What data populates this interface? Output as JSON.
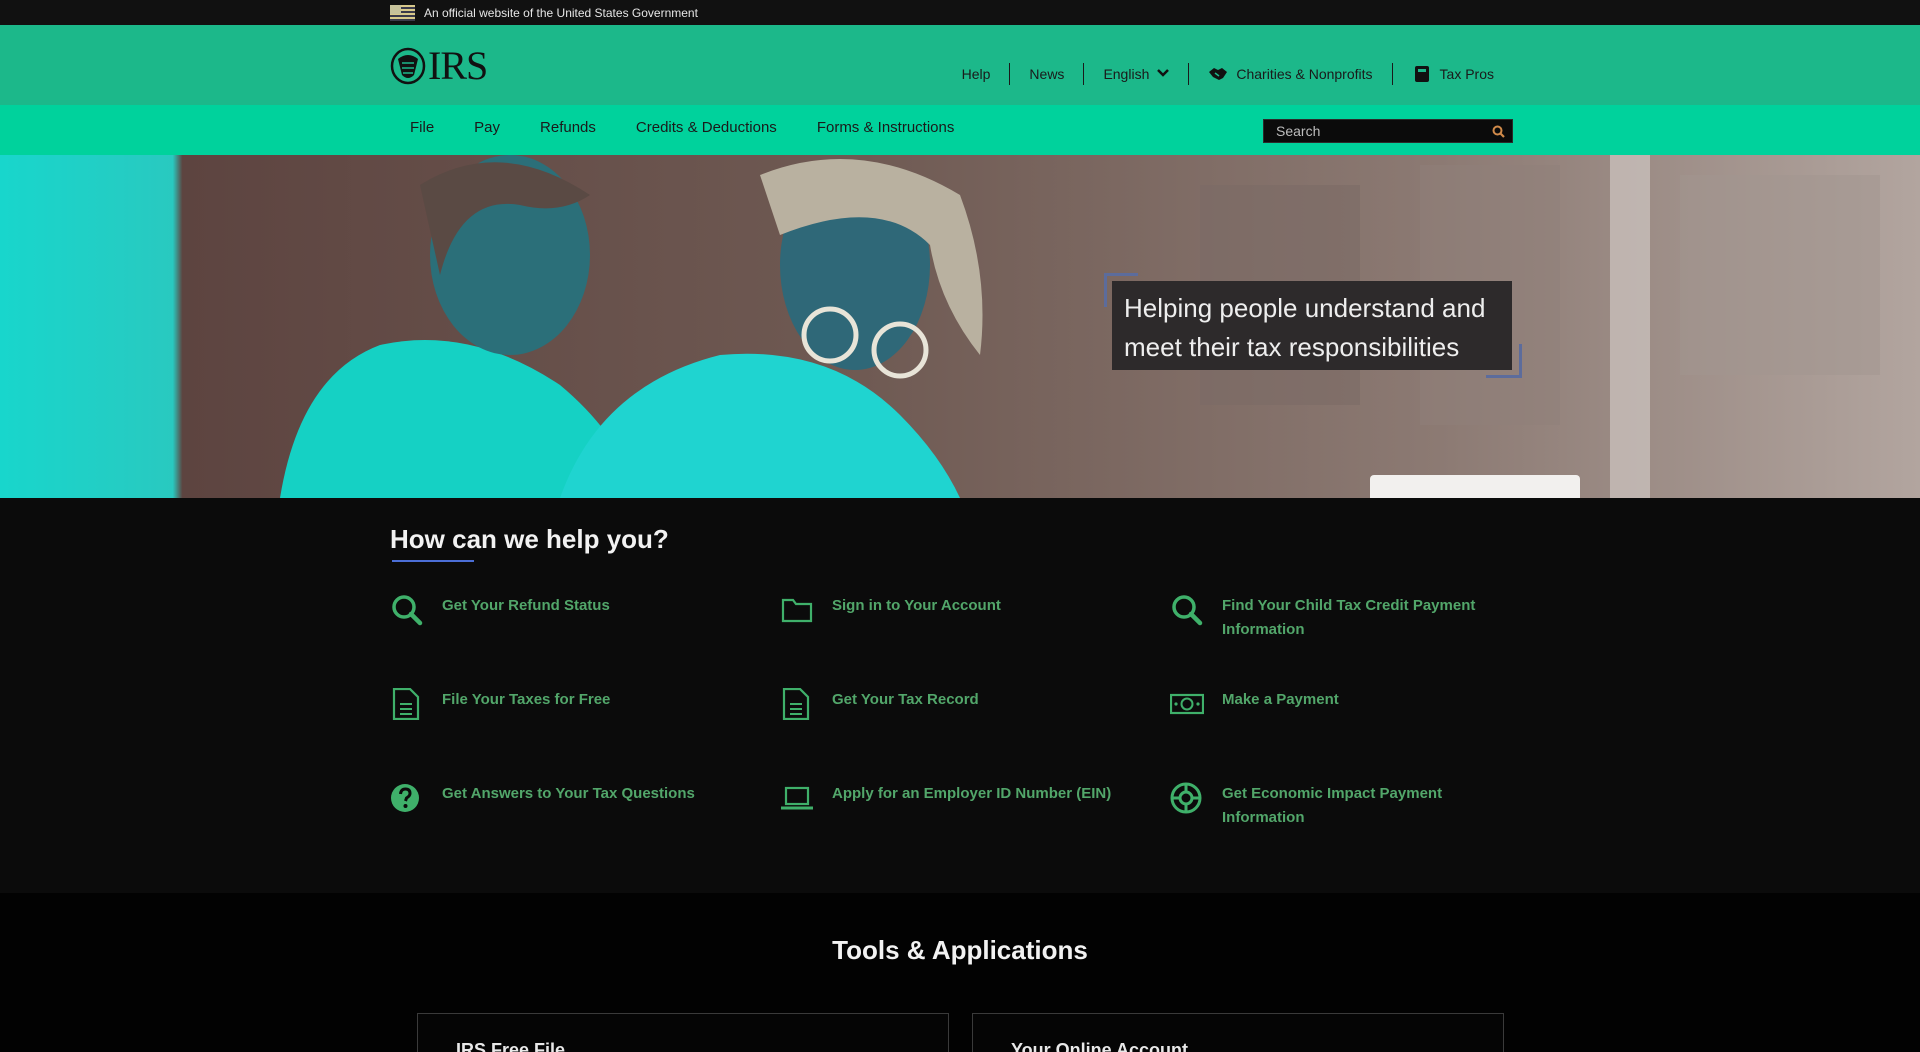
{
  "gov_banner": {
    "text": "An official website of the United States Government"
  },
  "header": {
    "logo_text": "IRS",
    "util_nav": [
      {
        "label": "Help"
      },
      {
        "label": "News"
      },
      {
        "label": "English"
      },
      {
        "label": "Charities & Nonprofits"
      },
      {
        "label": "Tax Pros"
      }
    ]
  },
  "main_nav": {
    "items": [
      {
        "label": "File"
      },
      {
        "label": "Pay"
      },
      {
        "label": "Refunds"
      },
      {
        "label": "Credits & Deductions"
      },
      {
        "label": "Forms & Instructions"
      }
    ],
    "search_placeholder": "Search"
  },
  "hero": {
    "caption_line1": "Helping people understand and",
    "caption_line2": "meet their tax responsibilities"
  },
  "help": {
    "title": "How can we help you?",
    "links": [
      {
        "label": "Get Your Refund Status",
        "icon": "search-icon"
      },
      {
        "label": "Sign in to Your Account",
        "icon": "folder-icon"
      },
      {
        "label": "Find Your Child Tax Credit Payment Information",
        "icon": "search-icon"
      },
      {
        "label": "File Your Taxes for Free",
        "icon": "document-icon"
      },
      {
        "label": "Get Your Tax Record",
        "icon": "document-icon"
      },
      {
        "label": "Make a Payment",
        "icon": "money-icon"
      },
      {
        "label": "Get Answers to Your Tax Questions",
        "icon": "question-icon"
      },
      {
        "label": "Apply for an Employer ID Number (EIN)",
        "icon": "laptop-icon"
      },
      {
        "label": "Get Economic Impact Payment Information",
        "icon": "lifebuoy-icon"
      }
    ]
  },
  "tools": {
    "title": "Tools & Applications",
    "cards": [
      {
        "label": "IRS Free File"
      },
      {
        "label": "Your Online Account"
      }
    ]
  },
  "colors": {
    "header_green": "#1cb88a",
    "nav_green": "#00d29c",
    "link_green": "#52a66a",
    "accent_blue": "#4b6ed6"
  }
}
